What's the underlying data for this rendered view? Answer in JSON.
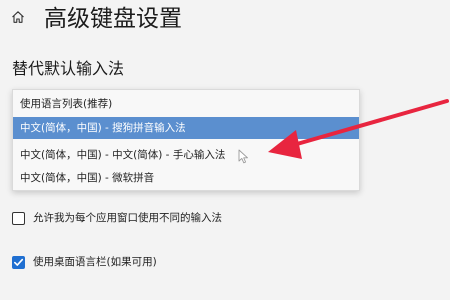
{
  "header": {
    "title": "高级键盘设置",
    "home_icon": "home-icon"
  },
  "override_section": {
    "title": "替代默认输入法",
    "dropdown": {
      "options": [
        "使用语言列表(推荐)",
        "中文(简体，中国) - 搜狗拼音输入法",
        "中文(简体，中国) - 中文(简体) - 手心输入法",
        "中文(简体，中国) - 微软拼音"
      ],
      "highlighted_index": 1,
      "highlight_color": "#5b8fcf"
    }
  },
  "annotation": {
    "arrow_color": "#e8253f"
  },
  "options": {
    "per_app_window": {
      "label": "允许我为每个应用窗口使用不同的输入法",
      "checked": false
    },
    "desktop_language_bar": {
      "label": "使用桌面语言栏(如果可用)",
      "checked": true,
      "accent": "#1f6fd1"
    }
  }
}
